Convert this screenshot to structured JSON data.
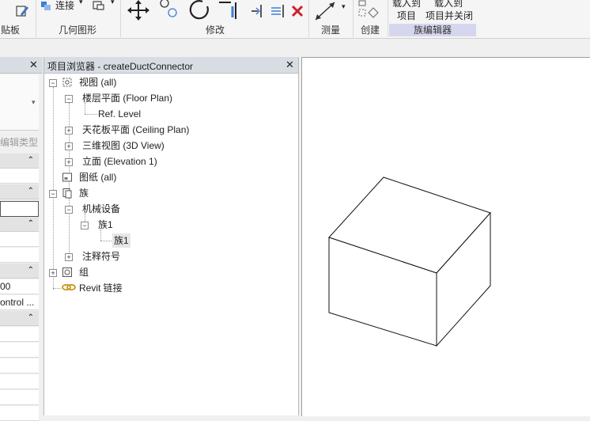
{
  "ribbon": {
    "clipboard_label": "贴板",
    "connect_label": "连接",
    "geometry_label": "几何图形",
    "modify_label": "修改",
    "measure_label": "测量",
    "create_label": "创建",
    "family_editor_label": "族编辑器",
    "load_into_project_label_line1": "载入到",
    "load_into_project_label_line2": "项目",
    "load_and_close_label_line1": "载入到",
    "load_and_close_label_line2": "项目并关闭"
  },
  "properties": {
    "edit_type_label": "编辑类型",
    "row_value_1": "00",
    "row_value_2": "ontrol ..."
  },
  "browser": {
    "title": "项目浏览器 - createDuctConnector",
    "tree": {
      "views": "视图 (all)",
      "floor_plan": "楼层平面 (Floor Plan)",
      "ref_level": "Ref. Level",
      "ceiling_plan": "天花板平面 (Ceiling Plan)",
      "view_3d": "三维视图 (3D View)",
      "elevation": "立面 (Elevation 1)",
      "sheets": "图纸 (all)",
      "families": "族",
      "mech_equipment": "机械设备",
      "family1": "族1",
      "family1_leaf": "族1",
      "annotation_symbols": "注释符号",
      "groups": "组",
      "revit_links": "Revit 链接"
    }
  },
  "colors": {
    "panel_header": "#d8dde3",
    "close_red": "#d0202a",
    "highlight": "#d6d6ee"
  }
}
